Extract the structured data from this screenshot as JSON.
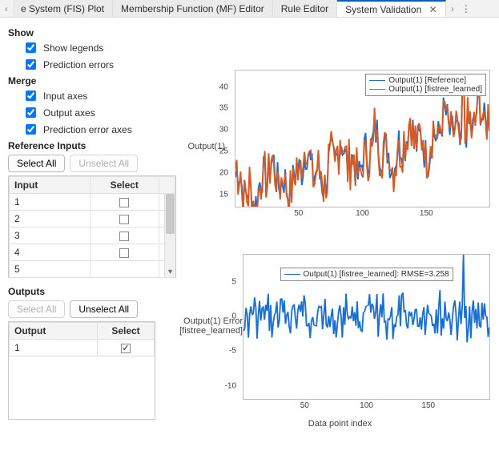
{
  "tabs": {
    "prev": "‹",
    "t1": "e System (FIS) Plot",
    "t2": "Membership Function (MF) Editor",
    "t3": "Rule Editor",
    "t4": "System Validation",
    "close": "✕",
    "next": "›",
    "kebab": "⋮"
  },
  "left": {
    "show_title": "Show",
    "legends_label": "Show legends",
    "prederr_label": "Prediction errors",
    "merge_title": "Merge",
    "input_axes_label": "Input axes",
    "output_axes_label": "Output axes",
    "pred_axes_label": "Prediction error axes",
    "ref_in_title": "Reference Inputs",
    "select_all": "Select All",
    "unselect_all": "Unselect All",
    "input_col": "Input",
    "select_col": "Select",
    "inputs": [
      "1",
      "2",
      "3",
      "4",
      "5"
    ],
    "outputs_title": "Outputs",
    "output_col": "Output",
    "outputs": [
      "1"
    ]
  },
  "plot1": {
    "ylabel": "Output(1)",
    "legend_ref": "Output(1) [Reference]",
    "legend_fit": "Output(1) [fistree_learned]"
  },
  "plot2": {
    "ylabel1": "Output(1) Error",
    "ylabel2": "[fistree_learned]",
    "xlabel": "Data point index",
    "legend": "Output(1) [fistree_learned]: RMSE=3.258"
  },
  "chart_data": [
    {
      "type": "line",
      "title": "",
      "xlabel": "",
      "ylabel": "Output(1)",
      "xlim": [
        0,
        200
      ],
      "ylim": [
        12,
        44
      ],
      "yticks": [
        15,
        20,
        25,
        30,
        35,
        40
      ],
      "xticks": [
        50,
        100,
        150
      ],
      "series": [
        {
          "name": "Output(1) [Reference]",
          "color": "#1b6fd1"
        },
        {
          "name": "Output(1) [fistree_learned]",
          "color": "#d65a23"
        }
      ],
      "note": "200-point noisy overlapping sequences with upward trend from ~15 to ~32; spike to ~43 near x≈180"
    },
    {
      "type": "line",
      "title": "",
      "xlabel": "Data point index",
      "ylabel": "Output(1) Error [fistree_learned]",
      "xlim": [
        0,
        200
      ],
      "ylim": [
        -12,
        9
      ],
      "yticks": [
        -10,
        -5,
        0,
        5
      ],
      "xticks": [
        50,
        100,
        150
      ],
      "series": [
        {
          "name": "Output(1) [fistree_learned]: RMSE=3.258",
          "color": "#1b6fd1"
        }
      ],
      "note": "error trace centered near 0, range roughly -10..7, large positive spike ~9 near x≈180"
    }
  ]
}
